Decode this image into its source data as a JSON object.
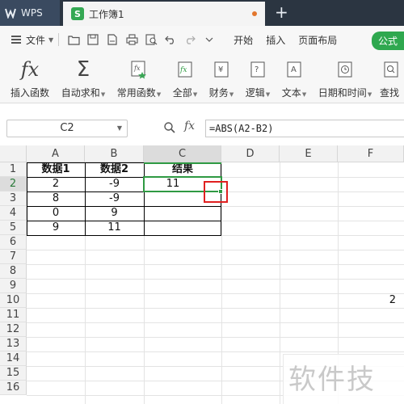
{
  "titlebar": {
    "app_name": "WPS",
    "doc_tab_title": "工作簿1",
    "doc_icon_letter": "S",
    "new_tab_label": "+"
  },
  "menubar": {
    "file_label": "文件",
    "items": [
      "开始",
      "插入",
      "页面布局"
    ],
    "active_tab": "公式"
  },
  "ribbon": {
    "buttons": [
      {
        "label": "插入函数",
        "icon": "fx-icon",
        "caret": false
      },
      {
        "label": "自动求和",
        "icon": "sigma-icon",
        "caret": true
      },
      {
        "label": "常用函数",
        "icon": "star-fx-icon",
        "caret": true
      },
      {
        "label": "全部",
        "icon": "fx-box-icon",
        "caret": true
      },
      {
        "label": "财务",
        "icon": "yen-icon",
        "caret": true
      },
      {
        "label": "逻辑",
        "icon": "question-book-icon",
        "caret": true
      },
      {
        "label": "文本",
        "icon": "text-a-icon",
        "caret": true
      },
      {
        "label": "日期和时间",
        "icon": "clock-icon",
        "caret": true
      },
      {
        "label": "查找",
        "icon": "search-book-icon",
        "caret": false
      }
    ]
  },
  "formulabar": {
    "cell_ref": "C2",
    "fx_label": "fx",
    "formula": "=ABS(A2-B2)"
  },
  "grid": {
    "columns": [
      "A",
      "B",
      "C",
      "D",
      "E",
      "F"
    ],
    "active_column": "C",
    "rows": [
      "1",
      "2",
      "3",
      "4",
      "5",
      "6",
      "7",
      "8",
      "9",
      "10",
      "11",
      "12",
      "13",
      "14",
      "15",
      "16"
    ],
    "active_row": "2",
    "table": {
      "headers": [
        "数据1",
        "数据2",
        "结果"
      ],
      "rows": [
        [
          "2",
          "-9",
          "11"
        ],
        [
          "8",
          "-9",
          ""
        ],
        [
          "0",
          "9",
          ""
        ],
        [
          "9",
          "11",
          ""
        ]
      ]
    },
    "stray_value": "2",
    "selected_cell": "C2"
  },
  "watermark": "软件技巧",
  "colors": {
    "titlebar": "#2b3541",
    "accent_green": "#2f9a43",
    "highlight_red": "#e02020"
  }
}
